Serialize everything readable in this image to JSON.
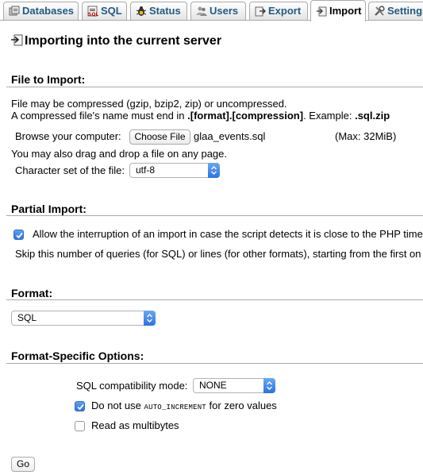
{
  "tabs": [
    {
      "label": "Databases",
      "icon": "databases-icon"
    },
    {
      "label": "SQL",
      "icon": "sql-icon"
    },
    {
      "label": "Status",
      "icon": "status-icon"
    },
    {
      "label": "Users",
      "icon": "users-icon"
    },
    {
      "label": "Export",
      "icon": "export-icon"
    },
    {
      "label": "Import",
      "icon": "import-icon",
      "active": true
    },
    {
      "label": "Settings",
      "icon": "settings-icon"
    }
  ],
  "page_title": "Importing into the current server",
  "file_import": {
    "heading": "File to Import:",
    "line1": "File may be compressed (gzip, bzip2, zip) or uncompressed.",
    "line2_prefix": "A compressed file's name must end in ",
    "line2_pattern": ".[format].[compression]",
    "line2_mid": ". Example: ",
    "line2_example": ".sql.zip",
    "browse_label": "Browse your computer:",
    "choose_file_button": "Choose File",
    "file_name": "glaa_events.sql",
    "max_size": "(Max: 32MiB)",
    "drag_drop": "You may also drag and drop a file on any page.",
    "charset_label": "Character set of the file:",
    "charset_value": "utf-8"
  },
  "partial_import": {
    "heading": "Partial Import:",
    "allow_interrupt_checked": true,
    "allow_interrupt_label": "Allow the interruption of an import in case the script detects it is close to the PHP time",
    "skip_queries_label": "Skip this number of queries (for SQL) or lines (for other formats), starting from the first on"
  },
  "format": {
    "heading": "Format:",
    "value": "SQL"
  },
  "format_options": {
    "heading": "Format-Specific Options:",
    "compat_label": "SQL compatibility mode:",
    "compat_value": "NONE",
    "no_auto_inc_checked": true,
    "no_auto_inc_prefix": "Do not use",
    "no_auto_inc_code": "AUTO_INCREMENT",
    "no_auto_inc_suffix": "for zero values",
    "multibytes_checked": false,
    "multibytes_label": "Read as multibytes"
  },
  "go_button": "Go",
  "colors": {
    "tab_text": "#235a81",
    "checkbox_accent": "#2a74e0"
  }
}
